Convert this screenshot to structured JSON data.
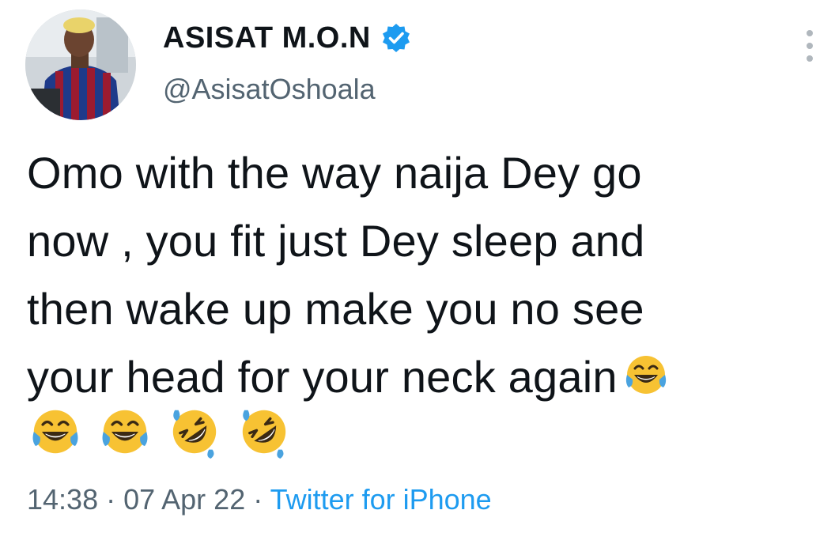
{
  "author": {
    "display_name": "ASISAT M.O.N",
    "handle": "@AsisatOshoala",
    "verified": true,
    "verified_color": "#1d9bf0"
  },
  "tweet": {
    "text": "Omo with the way naija Dey go\nnow , you fit just Dey sleep and\nthen wake up make you no see\nyour head for your neck again",
    "emojis_inline": [
      "face-with-tears-of-joy"
    ],
    "emojis_row": [
      "face-with-tears-of-joy",
      "face-with-tears-of-joy",
      "rolling-on-the-floor-laughing",
      "rolling-on-the-floor-laughing"
    ]
  },
  "meta": {
    "time": "14:38",
    "separator1": " · ",
    "date": "07 Apr 22",
    "separator2": " · ",
    "source": "Twitter for iPhone"
  },
  "colors": {
    "text": "#0f1419",
    "secondary": "#536471",
    "link": "#1d9bf0"
  }
}
